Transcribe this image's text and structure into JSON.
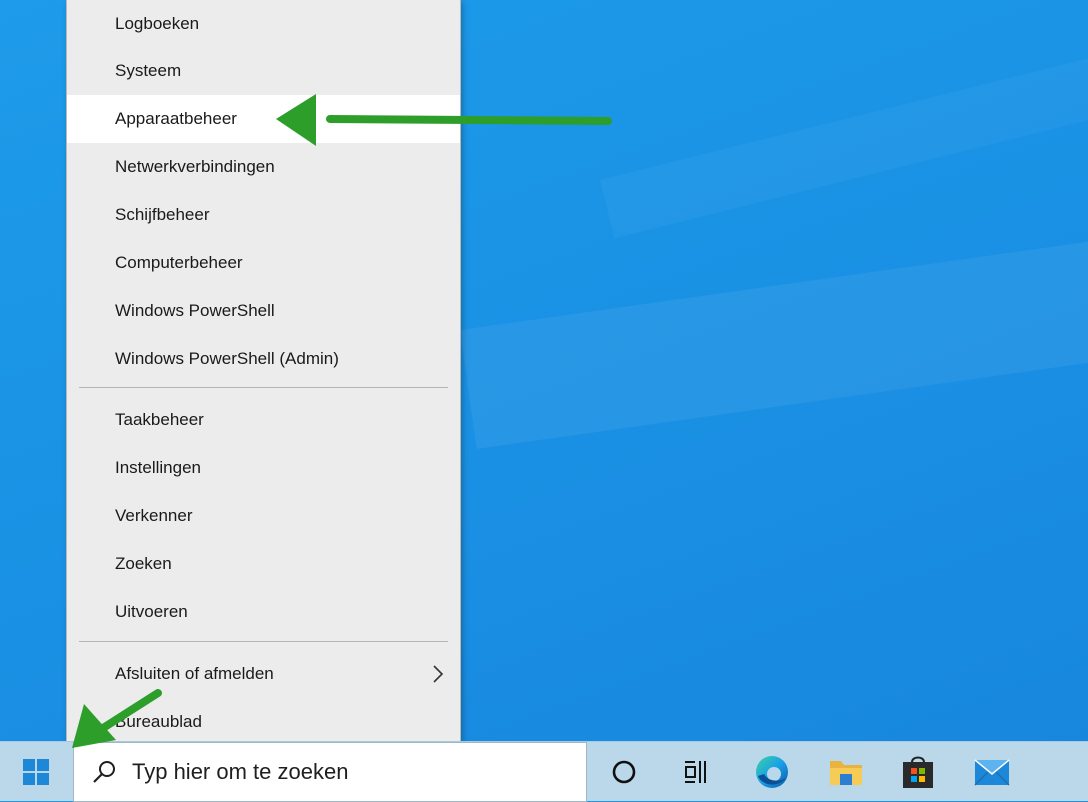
{
  "menu": {
    "items_top": [
      {
        "label": "Logboeken"
      },
      {
        "label": "Systeem"
      },
      {
        "label": "Apparaatbeheer",
        "highlighted": true
      },
      {
        "label": "Netwerkverbindingen"
      },
      {
        "label": "Schijfbeheer"
      },
      {
        "label": "Computerbeheer"
      },
      {
        "label": "Windows PowerShell"
      },
      {
        "label": "Windows PowerShell (Admin)"
      }
    ],
    "items_middle": [
      {
        "label": "Taakbeheer"
      },
      {
        "label": "Instellingen"
      },
      {
        "label": "Verkenner"
      },
      {
        "label": "Zoeken"
      },
      {
        "label": "Uitvoeren"
      }
    ],
    "items_bottom": [
      {
        "label": "Afsluiten of afmelden",
        "has_submenu": true
      },
      {
        "label": "Bureaublad"
      }
    ]
  },
  "taskbar": {
    "search_placeholder": "Typ hier om te zoeken",
    "icons": [
      "windows-start-icon",
      "search-icon",
      "cortana-icon",
      "task-view-icon",
      "edge-icon",
      "file-explorer-icon",
      "store-icon",
      "mail-icon"
    ]
  },
  "annotations": {
    "arrow_color": "#2e9e2a"
  },
  "colors": {
    "desktop_blue": "#1b95e6",
    "menu_bg": "#ececec",
    "highlight_bg": "#ffffff",
    "taskbar_bg": "#bad8ea"
  }
}
